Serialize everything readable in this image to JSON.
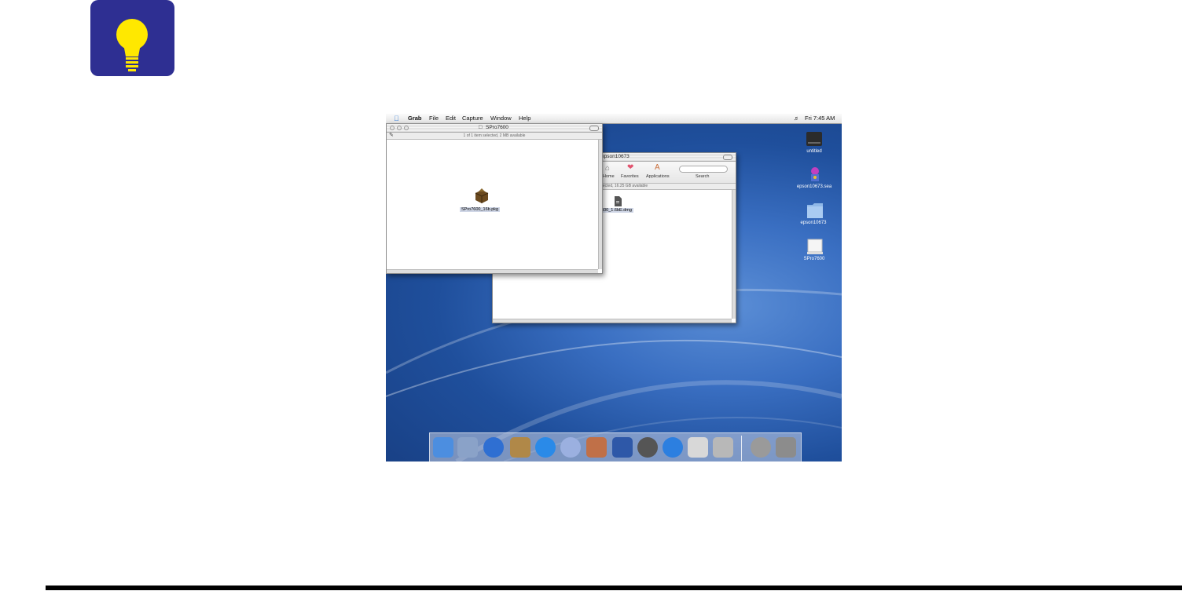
{
  "menubar": {
    "app": "Grab",
    "items": [
      "File",
      "Edit",
      "Capture",
      "Window",
      "Help"
    ],
    "clock": "Fri 7:45 AM"
  },
  "window_front": {
    "title": "SPro7600",
    "status": "1 of 1 item selected, 2 MB available",
    "file": "SPro7600_16b.pkg"
  },
  "window_back": {
    "title": "epson10673",
    "toolbar": [
      "Home",
      "Favorites",
      "Applications",
      "Search"
    ],
    "status": "elected, 16.25 GB available",
    "file": "7600_1.6bE.dmg"
  },
  "desktop_icons": [
    "untitled",
    "epson10673.sea",
    "epson10673",
    "SPro7600"
  ],
  "colors": {
    "tip_bg": "#2e2f92",
    "bulb": "#ffe800",
    "desktop": "#2a5aa8"
  },
  "dock_icons": [
    "finder-icon",
    "mail-icon",
    "ichat-icon",
    "address-book-icon",
    "internet-explorer-icon",
    "itunes-icon",
    "iphoto-icon",
    "imovie-icon",
    "sherlock-icon",
    "quicktime-icon",
    "system-preferences-icon",
    "grab-icon",
    "mail-at-icon",
    "trash-icon"
  ]
}
